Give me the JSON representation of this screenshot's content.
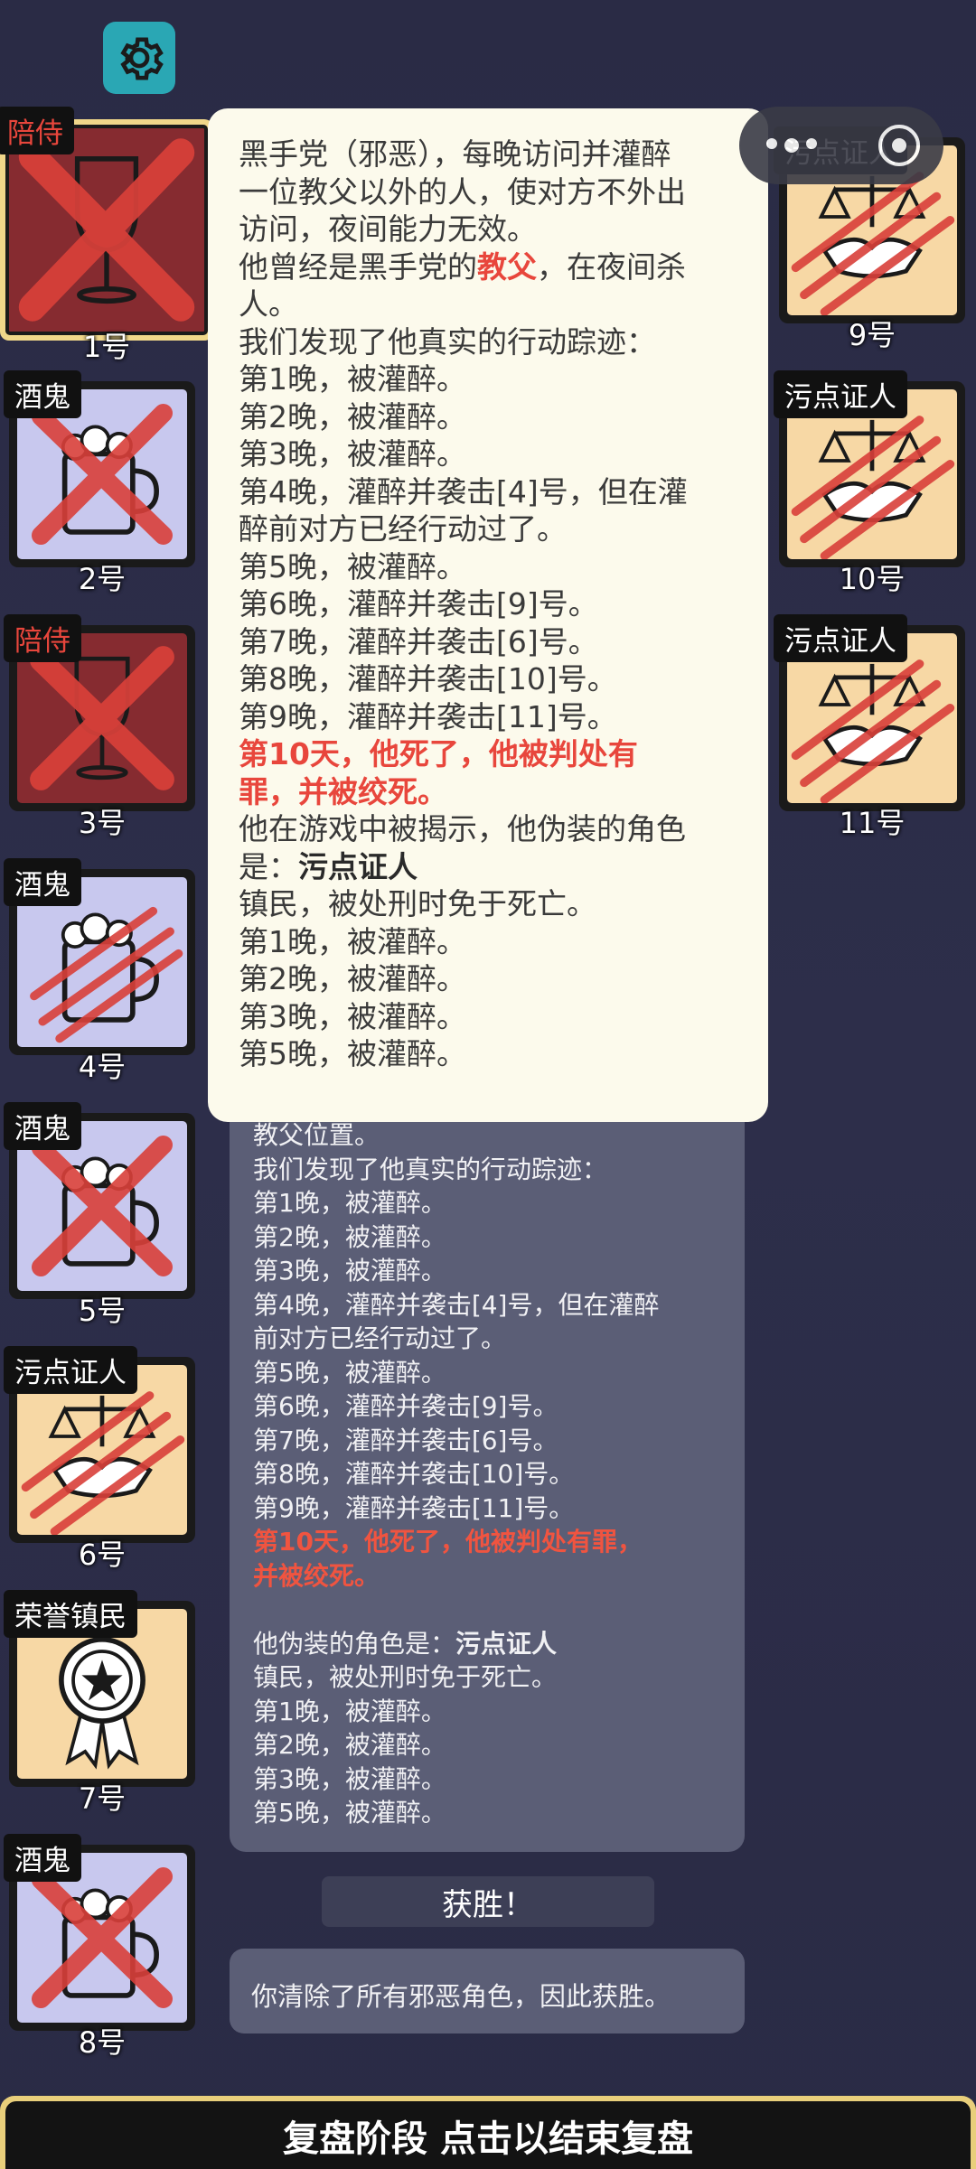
{
  "settings": {
    "icon": "gear-icon"
  },
  "players": {
    "p1": {
      "role": "陪侍",
      "num": "1号"
    },
    "p2": {
      "role": "酒鬼",
      "num": "2号"
    },
    "p3": {
      "role": "陪侍",
      "num": "3号"
    },
    "p4": {
      "role": "酒鬼",
      "num": "4号"
    },
    "p5": {
      "role": "酒鬼",
      "num": "5号"
    },
    "p6": {
      "role": "污点证人",
      "num": "6号"
    },
    "p7": {
      "role": "荣誉镇民",
      "num": "7号"
    },
    "p8": {
      "role": "酒鬼",
      "num": "8号"
    },
    "p9": {
      "role": "污点证人",
      "num": "9号"
    },
    "p10": {
      "role": "污点证人",
      "num": "10号"
    },
    "p11": {
      "role": "污点证人",
      "num": "11号"
    }
  },
  "popup": {
    "l1": "黑手党（邪恶），每晚访问并灌醉",
    "l2": "一位教父以外的人，使对方不外出",
    "l3": "访问，夜间能力无效。",
    "l4a": "他曾经是黑手党的",
    "l4b": "教父",
    "l4c": "，在夜间杀",
    "l5": "人。",
    "l6": "我们发现了他真实的行动踪迹：",
    "l7": "第1晚，被灌醉。",
    "l8": "第2晚，被灌醉。",
    "l9": "第3晚，被灌醉。",
    "l10": "第4晚，灌醉并袭击[4]号，但在灌",
    "l11": "醉前对方已经行动过了。",
    "l12": "第5晚，被灌醉。",
    "l13": "第6晚，灌醉并袭击[9]号。",
    "l14": "第7晚，灌醉并袭击[6]号。",
    "l15": "第8晚，灌醉并袭击[10]号。",
    "l16": "第9晚，灌醉并袭击[11]号。",
    "l17": "第10天，他死了，他被判处有",
    "l18": "罪，并被绞死。",
    "l19": "他在游戏中被揭示，他伪装的角色",
    "l20a": "是：",
    "l20b": "污点证人",
    "l21": "镇民，被处刑时免于死亡。",
    "l22": "第1晚，被灌醉。",
    "l23": "第2晚，被灌醉。",
    "l24": "第3晚，被灌醉。",
    "l25": "第5晚，被灌醉。"
  },
  "log": {
    "l1": "教父位置。",
    "l2": "我们发现了他真实的行动踪迹：",
    "l3": "第1晚，被灌醉。",
    "l4": "第2晚，被灌醉。",
    "l5": "第3晚，被灌醉。",
    "l6": "第4晚，灌醉并袭击[4]号，但在灌醉",
    "l7": "前对方已经行动过了。",
    "l8": "第5晚，被灌醉。",
    "l9": "第6晚，灌醉并袭击[9]号。",
    "l10": "第7晚，灌醉并袭击[6]号。",
    "l11": "第8晚，灌醉并袭击[10]号。",
    "l12": "第9晚，灌醉并袭击[11]号。",
    "l13": "第10天，他死了，他被判处有罪，",
    "l14": "并被绞死。",
    "l15a": "他伪装的角色是：",
    "l15b": "污点证人",
    "l16": "镇民，被处刑时免于死亡。",
    "l17": "第1晚，被灌醉。",
    "l18": "第2晚，被灌醉。",
    "l19": "第3晚，被灌醉。",
    "l20": "第5晚，被灌醉。"
  },
  "victory": {
    "button": "获胜！",
    "message": "你清除了所有邪恶角色，因此获胜。"
  },
  "footer": {
    "label": "复盘阶段 点击以结束复盘"
  }
}
